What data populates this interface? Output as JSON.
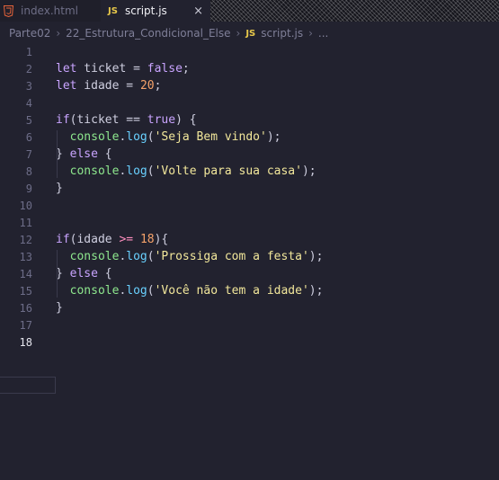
{
  "tabs": [
    {
      "label": "index.html",
      "icon": "html5-icon",
      "active": false
    },
    {
      "label": "script.js",
      "icon": "js-icon",
      "active": true,
      "close": "×"
    }
  ],
  "js_badge": "JS",
  "breadcrumb": [
    "Parte02",
    "22_Estrutura_Condicional_Else",
    "script.js",
    "..."
  ],
  "breadcrumb_sep": "›",
  "current_line": 18,
  "lines": [
    {
      "n": 1,
      "tokens": []
    },
    {
      "n": 2,
      "tokens": [
        [
          "kw",
          "let"
        ],
        [
          "",
          ""
        ],
        [
          "plain",
          " ticket = "
        ],
        [
          "bool",
          "false"
        ],
        [
          "plain",
          ";"
        ]
      ]
    },
    {
      "n": 3,
      "tokens": [
        [
          "kw",
          "let"
        ],
        [
          "plain",
          " idade = "
        ],
        [
          "num",
          "20"
        ],
        [
          "plain",
          ";"
        ]
      ]
    },
    {
      "n": 4,
      "tokens": []
    },
    {
      "n": 5,
      "tokens": [
        [
          "kw",
          "if"
        ],
        [
          "plain",
          "(ticket == "
        ],
        [
          "bool",
          "true"
        ],
        [
          "plain",
          ") {"
        ]
      ]
    },
    {
      "n": 6,
      "tokens": [
        [
          "plain",
          "  "
        ],
        [
          "obj",
          "console"
        ],
        [
          "plain",
          "."
        ],
        [
          "fn",
          "log"
        ],
        [
          "plain",
          "("
        ],
        [
          "str",
          "'Seja Bem vindo'"
        ],
        [
          "plain",
          ");"
        ]
      ]
    },
    {
      "n": 7,
      "tokens": [
        [
          "plain",
          "} "
        ],
        [
          "kw",
          "else"
        ],
        [
          "plain",
          " {"
        ]
      ]
    },
    {
      "n": 8,
      "tokens": [
        [
          "plain",
          "  "
        ],
        [
          "obj",
          "console"
        ],
        [
          "plain",
          "."
        ],
        [
          "fn",
          "log"
        ],
        [
          "plain",
          "("
        ],
        [
          "str",
          "'Volte para sua casa'"
        ],
        [
          "plain",
          ");"
        ]
      ]
    },
    {
      "n": 9,
      "tokens": [
        [
          "plain",
          "}"
        ]
      ]
    },
    {
      "n": 10,
      "tokens": []
    },
    {
      "n": 11,
      "tokens": []
    },
    {
      "n": 12,
      "tokens": [
        [
          "kw",
          "if"
        ],
        [
          "plain",
          "(idade "
        ],
        [
          "op",
          ">="
        ],
        [
          "plain",
          " "
        ],
        [
          "num",
          "18"
        ],
        [
          "plain",
          "){"
        ]
      ]
    },
    {
      "n": 13,
      "tokens": [
        [
          "plain",
          "  "
        ],
        [
          "obj",
          "console"
        ],
        [
          "plain",
          "."
        ],
        [
          "fn",
          "log"
        ],
        [
          "plain",
          "("
        ],
        [
          "str",
          "'Prossiga com a festa'"
        ],
        [
          "plain",
          ");"
        ]
      ]
    },
    {
      "n": 14,
      "tokens": [
        [
          "plain",
          "} "
        ],
        [
          "kw",
          "else"
        ],
        [
          "plain",
          " {"
        ]
      ]
    },
    {
      "n": 15,
      "tokens": [
        [
          "plain",
          "  "
        ],
        [
          "obj",
          "console"
        ],
        [
          "plain",
          "."
        ],
        [
          "fn",
          "log"
        ],
        [
          "plain",
          "("
        ],
        [
          "str",
          "'Você não tem a idade'"
        ],
        [
          "plain",
          ");"
        ]
      ]
    },
    {
      "n": 16,
      "tokens": [
        [
          "plain",
          "}"
        ]
      ]
    },
    {
      "n": 17,
      "tokens": []
    },
    {
      "n": 18,
      "tokens": []
    }
  ],
  "colors": {
    "keyword": "#c9a4ff",
    "number": "#f5a26a",
    "string": "#f2e79b",
    "function": "#69d1ff",
    "object": "#8ee88e",
    "background": "#22222f"
  }
}
